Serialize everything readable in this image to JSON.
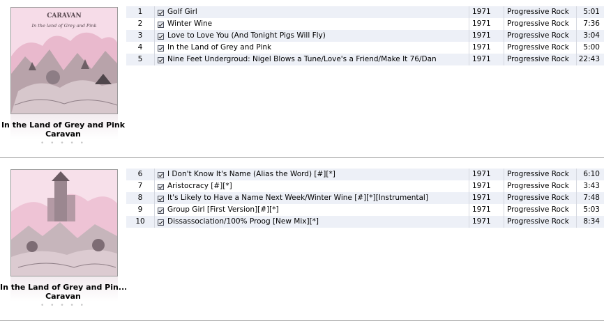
{
  "albums": [
    {
      "title": "In the Land of Grey and Pink",
      "artist": "Caravan",
      "rating_stars": "• • • • •",
      "cover_art_label": "CARAVAN",
      "cover_art_subtitle": "In the land of Grey and Pink",
      "tracks": [
        {
          "num": "1",
          "name": "Golf Girl",
          "year": "1971",
          "genre": "Progressive Rock",
          "time": "5:01",
          "checked": true
        },
        {
          "num": "2",
          "name": "Winter Wine",
          "year": "1971",
          "genre": "Progressive Rock",
          "time": "7:36",
          "checked": true
        },
        {
          "num": "3",
          "name": "Love to Love You (And Tonight Pigs Will Fly)",
          "year": "1971",
          "genre": "Progressive Rock",
          "time": "3:04",
          "checked": true
        },
        {
          "num": "4",
          "name": "In the Land of Grey and Pink",
          "year": "1971",
          "genre": "Progressive Rock",
          "time": "5:00",
          "checked": true
        },
        {
          "num": "5",
          "name": "Nine Feet Undergroud: Nigel Blows a Tune/Love's a Friend/Make It 76/Dan",
          "year": "1971",
          "genre": "Progressive Rock",
          "time": "22:43",
          "checked": true
        }
      ]
    },
    {
      "title": "In the Land of Grey and Pin...",
      "artist": "Caravan",
      "rating_stars": "• • • • •",
      "tracks": [
        {
          "num": "6",
          "name": "I Don't Know It's Name (Alias the Word) [#][*]",
          "year": "1971",
          "genre": "Progressive Rock",
          "time": "6:10",
          "checked": true
        },
        {
          "num": "7",
          "name": "Aristocracy [#][*]",
          "year": "1971",
          "genre": "Progressive Rock",
          "time": "3:43",
          "checked": true
        },
        {
          "num": "8",
          "name": "It's Likely to Have a Name Next Week/Winter Wine [#][*][Instrumental]",
          "year": "1971",
          "genre": "Progressive Rock",
          "time": "7:48",
          "checked": true
        },
        {
          "num": "9",
          "name": "Group Girl [First Version][#][*]",
          "year": "1971",
          "genre": "Progressive Rock",
          "time": "5:03",
          "checked": true
        },
        {
          "num": "10",
          "name": "Dissassociation/100% Proog [New Mix][*]",
          "year": "1971",
          "genre": "Progressive Rock",
          "time": "8:34",
          "checked": true
        }
      ]
    }
  ]
}
